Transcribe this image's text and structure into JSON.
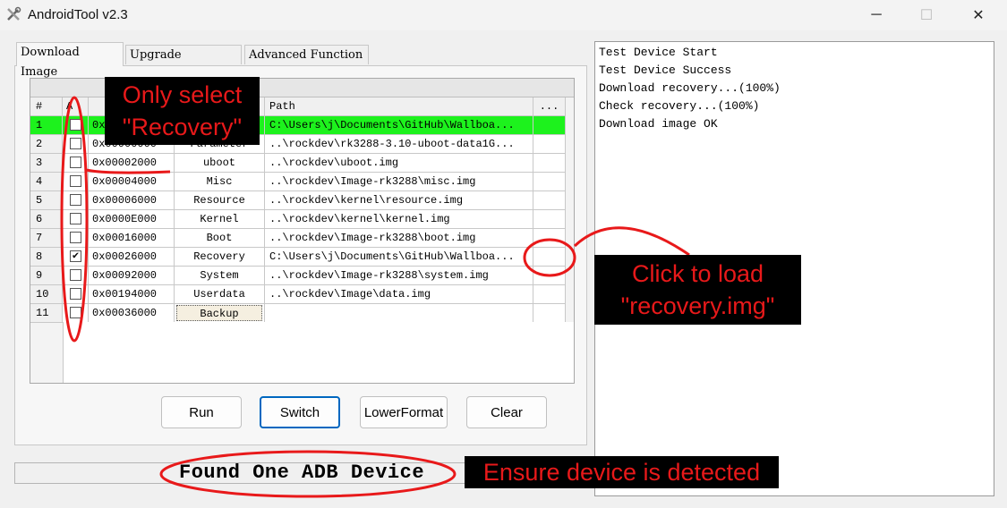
{
  "window": {
    "title": "AndroidTool v2.3",
    "minimize": "─",
    "maximize": "☐",
    "close": "✕"
  },
  "tabs": [
    {
      "label": "Download Image"
    },
    {
      "label": "Upgrade Firmware"
    },
    {
      "label": "Advanced Function"
    }
  ],
  "table": {
    "headers": {
      "num": "#",
      "chk": "A",
      "path": "Path",
      "more": "..."
    },
    "rows": [
      {
        "num": "1",
        "checked": false,
        "address": "0x",
        "name": "",
        "path": "C:\\Users\\j\\Documents\\GitHub\\Wallboa...",
        "more": ""
      },
      {
        "num": "2",
        "checked": false,
        "address": "0x00000000",
        "name": "Parameter",
        "path": "..\\rockdev\\rk3288-3.10-uboot-data1G...",
        "more": ""
      },
      {
        "num": "3",
        "checked": false,
        "address": "0x00002000",
        "name": "uboot",
        "path": "..\\rockdev\\uboot.img",
        "more": ""
      },
      {
        "num": "4",
        "checked": false,
        "address": "0x00004000",
        "name": "Misc",
        "path": "..\\rockdev\\Image-rk3288\\misc.img",
        "more": ""
      },
      {
        "num": "5",
        "checked": false,
        "address": "0x00006000",
        "name": "Resource",
        "path": "..\\rockdev\\kernel\\resource.img",
        "more": ""
      },
      {
        "num": "6",
        "checked": false,
        "address": "0x0000E000",
        "name": "Kernel",
        "path": "..\\rockdev\\kernel\\kernel.img",
        "more": ""
      },
      {
        "num": "7",
        "checked": false,
        "address": "0x00016000",
        "name": "Boot",
        "path": "..\\rockdev\\Image-rk3288\\boot.img",
        "more": ""
      },
      {
        "num": "8",
        "checked": true,
        "address": "0x00026000",
        "name": "Recovery",
        "path": "C:\\Users\\j\\Documents\\GitHub\\Wallboa...",
        "more": ""
      },
      {
        "num": "9",
        "checked": false,
        "address": "0x00092000",
        "name": "System",
        "path": "..\\rockdev\\Image-rk3288\\system.img",
        "more": ""
      },
      {
        "num": "10",
        "checked": false,
        "address": "0x00194000",
        "name": "Userdata",
        "path": "..\\rockdev\\Image\\data.img",
        "more": ""
      },
      {
        "num": "11",
        "checked": false,
        "address": "0x00036000",
        "name": "Backup",
        "path": "",
        "more": ""
      }
    ]
  },
  "buttons": {
    "run": "Run",
    "switch": "Switch",
    "lower_format": "LowerFormat",
    "clear": "Clear"
  },
  "status": {
    "text": "Found One ADB Device"
  },
  "log": {
    "lines": [
      "Test Device Start",
      "Test Device Success",
      "Download recovery...(100%)",
      "Check recovery...(100%)",
      "Download image OK"
    ]
  },
  "annotations": {
    "select_line1": "Only select",
    "select_line2": "\"Recovery\"",
    "load_line1": "Click to load",
    "load_line2": "\"recovery.img\"",
    "ensure": "Ensure device is detected"
  },
  "colors": {
    "selected_row": "#1df21d",
    "annotation_red": "#e8191a",
    "focus_blue": "#0067c0"
  },
  "icons": {
    "app": "tools-icon"
  }
}
